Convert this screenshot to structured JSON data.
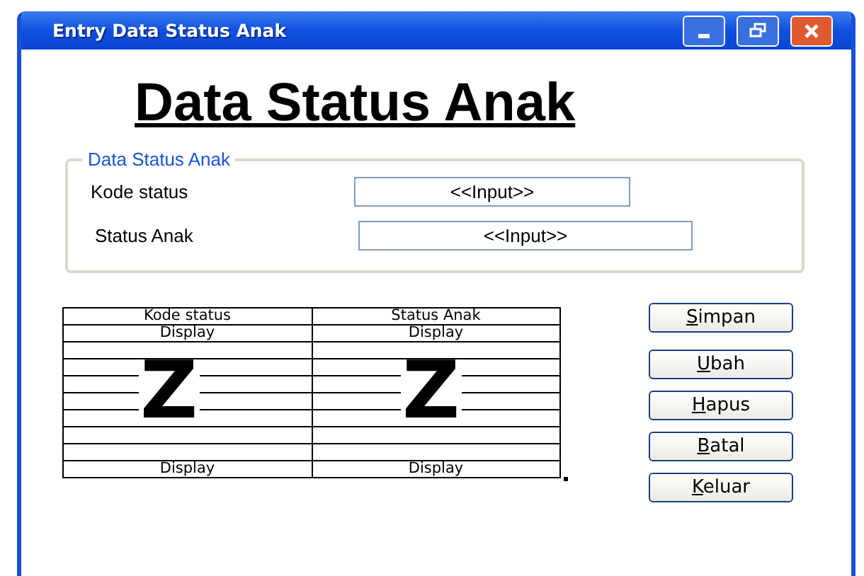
{
  "window": {
    "title": "Entry Data Status Anak"
  },
  "heading": "Data Status Anak",
  "group": {
    "legend": "Data Status Anak",
    "fields": [
      {
        "label": "Kode status",
        "placeholder": "<<Input>>"
      },
      {
        "label": "Status Anak",
        "placeholder": "<<Input>>"
      }
    ]
  },
  "table": {
    "columns": [
      "Kode status",
      "Status Anak"
    ],
    "empty_marks": [
      "Z",
      "Z"
    ],
    "rows": [
      [
        "Display",
        "Display"
      ],
      [
        "",
        ""
      ],
      [
        "",
        ""
      ],
      [
        "",
        ""
      ],
      [
        "",
        ""
      ],
      [
        "",
        ""
      ],
      [
        "",
        ""
      ],
      [
        "",
        ""
      ],
      [
        "Display",
        "Display"
      ]
    ]
  },
  "buttons": [
    "Simpan",
    "Ubah",
    "Hapus",
    "Batal",
    "Keluar"
  ]
}
